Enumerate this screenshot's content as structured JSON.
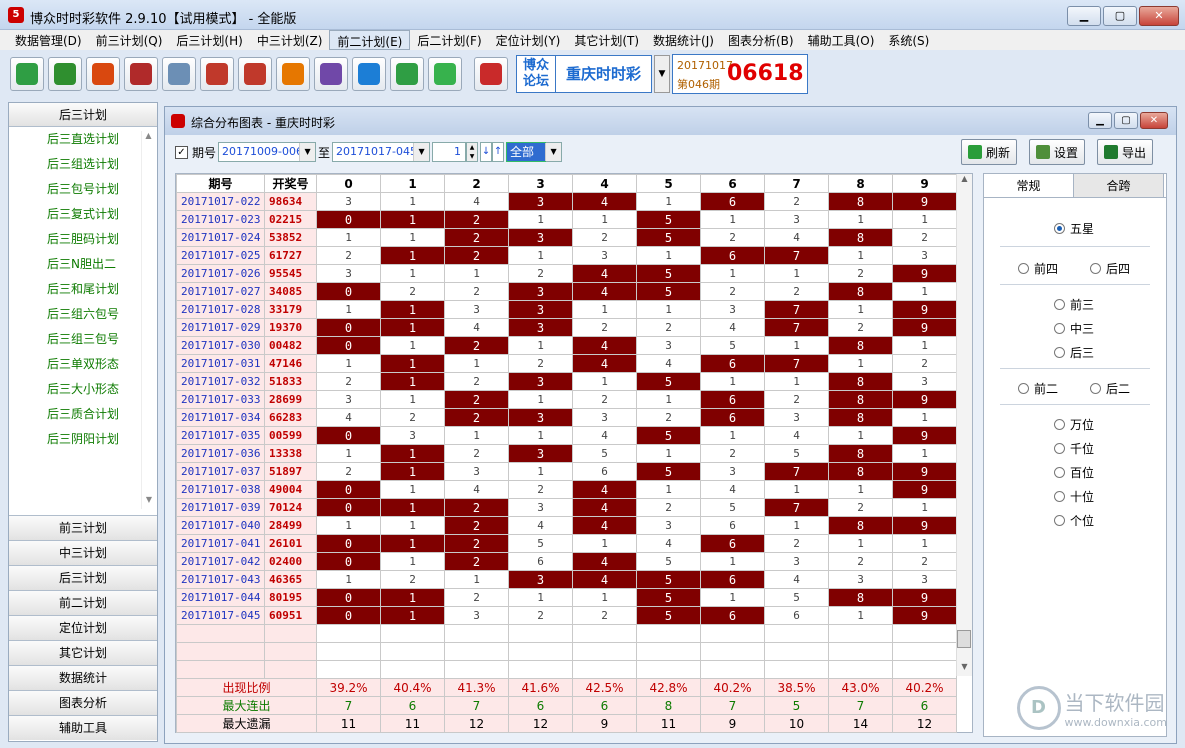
{
  "window": {
    "title": "博众时时彩软件 2.9.10【试用模式】 - 全能版",
    "icon_text": "5"
  },
  "menu": [
    "数据管理(D)",
    "前三计划(Q)",
    "后三计划(H)",
    "中三计划(Z)",
    "前二计划(E)",
    "后二计划(F)",
    "定位计划(Y)",
    "其它计划(T)",
    "数据统计(J)",
    "图表分析(B)",
    "辅助工具(O)",
    "系统(S)"
  ],
  "toolbar": {
    "icons": [
      "database-icon",
      "download-icon",
      "pie-chart-icon",
      "grid-chart-icon",
      "line-chart-icon",
      "bar-chart-icon",
      "bar-chart-icon",
      "alarm-icon",
      "matrix-icon",
      "calculator-icon",
      "gear-icon",
      "refresh-icon",
      "lottery-icon"
    ],
    "forum_logo": "博众\n论坛",
    "lottery_name": "重庆时时彩",
    "draw_date": "20171017",
    "draw_period": "第046期",
    "draw_number": "06618"
  },
  "sidebar": {
    "header": "后三计划",
    "links": [
      "后三直选计划",
      "后三组选计划",
      "后三包号计划",
      "后三复式计划",
      "后三胆码计划",
      "后三N胆出二",
      "后三和尾计划",
      "后三组六包号",
      "后三组三包号",
      "后三单双形态",
      "后三大小形态",
      "后三质合计划",
      "后三阴阳计划"
    ],
    "buttons": [
      "前三计划",
      "中三计划",
      "后三计划",
      "前二计划",
      "定位计划",
      "其它计划",
      "数据统计",
      "图表分析",
      "辅助工具"
    ]
  },
  "child": {
    "title": "综合分布图表 - 重庆时时彩"
  },
  "filter": {
    "checkbox_label": "期号",
    "from": "20171009-006",
    "to_label": "至",
    "to": "20171017-045",
    "step": "1",
    "range": "全部",
    "refresh": "刷新",
    "settings": "设置",
    "export": "导出"
  },
  "table": {
    "headers": [
      "期号",
      "开奖号",
      "0",
      "1",
      "2",
      "3",
      "4",
      "5",
      "6",
      "7",
      "8",
      "9"
    ],
    "rows": [
      {
        "period": "20171017-022",
        "num": "98634",
        "cells": [
          "3",
          "1",
          "4",
          "3",
          "4",
          "1",
          "6",
          "2",
          "8",
          "9"
        ],
        "hits": [
          3,
          4,
          6,
          8,
          9
        ]
      },
      {
        "period": "20171017-023",
        "num": "02215",
        "cells": [
          "0",
          "1",
          "2",
          "1",
          "1",
          "5",
          "1",
          "3",
          "1",
          "1"
        ],
        "hits": [
          0,
          1,
          2,
          5
        ]
      },
      {
        "period": "20171017-024",
        "num": "53852",
        "cells": [
          "1",
          "1",
          "2",
          "3",
          "2",
          "5",
          "2",
          "4",
          "8",
          "2"
        ],
        "hits": [
          2,
          3,
          5,
          8
        ]
      },
      {
        "period": "20171017-025",
        "num": "61727",
        "cells": [
          "2",
          "1",
          "2",
          "1",
          "3",
          "1",
          "6",
          "7",
          "1",
          "3"
        ],
        "hits": [
          1,
          2,
          6,
          7
        ]
      },
      {
        "period": "20171017-026",
        "num": "95545",
        "cells": [
          "3",
          "1",
          "1",
          "2",
          "4",
          "5",
          "1",
          "1",
          "2",
          "9"
        ],
        "hits": [
          4,
          5,
          9
        ]
      },
      {
        "period": "20171017-027",
        "num": "34085",
        "cells": [
          "0",
          "2",
          "2",
          "3",
          "4",
          "5",
          "2",
          "2",
          "8",
          "1"
        ],
        "hits": [
          0,
          3,
          4,
          5,
          8
        ]
      },
      {
        "period": "20171017-028",
        "num": "33179",
        "cells": [
          "1",
          "1",
          "3",
          "3",
          "1",
          "1",
          "3",
          "7",
          "1",
          "9"
        ],
        "hits": [
          1,
          3,
          7,
          9
        ]
      },
      {
        "period": "20171017-029",
        "num": "19370",
        "cells": [
          "0",
          "1",
          "4",
          "3",
          "2",
          "2",
          "4",
          "7",
          "2",
          "9"
        ],
        "hits": [
          0,
          1,
          3,
          7,
          9
        ]
      },
      {
        "period": "20171017-030",
        "num": "00482",
        "cells": [
          "0",
          "1",
          "2",
          "1",
          "4",
          "3",
          "5",
          "1",
          "8",
          "1"
        ],
        "hits": [
          0,
          2,
          4,
          8
        ]
      },
      {
        "period": "20171017-031",
        "num": "47146",
        "cells": [
          "1",
          "1",
          "1",
          "2",
          "4",
          "4",
          "6",
          "7",
          "1",
          "2"
        ],
        "hits": [
          1,
          4,
          6,
          7
        ]
      },
      {
        "period": "20171017-032",
        "num": "51833",
        "cells": [
          "2",
          "1",
          "2",
          "3",
          "1",
          "5",
          "1",
          "1",
          "8",
          "3"
        ],
        "hits": [
          1,
          3,
          5,
          8
        ]
      },
      {
        "period": "20171017-033",
        "num": "28699",
        "cells": [
          "3",
          "1",
          "2",
          "1",
          "2",
          "1",
          "6",
          "2",
          "8",
          "9"
        ],
        "hits": [
          2,
          6,
          8,
          9
        ]
      },
      {
        "period": "20171017-034",
        "num": "66283",
        "cells": [
          "4",
          "2",
          "2",
          "3",
          "3",
          "2",
          "6",
          "3",
          "8",
          "1"
        ],
        "hits": [
          2,
          3,
          6,
          8
        ]
      },
      {
        "period": "20171017-035",
        "num": "00599",
        "cells": [
          "0",
          "3",
          "1",
          "1",
          "4",
          "5",
          "1",
          "4",
          "1",
          "9"
        ],
        "hits": [
          0,
          5,
          9
        ]
      },
      {
        "period": "20171017-036",
        "num": "13338",
        "cells": [
          "1",
          "1",
          "2",
          "3",
          "5",
          "1",
          "2",
          "5",
          "8",
          "1"
        ],
        "hits": [
          1,
          3,
          8
        ]
      },
      {
        "period": "20171017-037",
        "num": "51897",
        "cells": [
          "2",
          "1",
          "3",
          "1",
          "6",
          "5",
          "3",
          "7",
          "8",
          "9"
        ],
        "hits": [
          1,
          5,
          7,
          8,
          9
        ]
      },
      {
        "period": "20171017-038",
        "num": "49004",
        "cells": [
          "0",
          "1",
          "4",
          "2",
          "4",
          "1",
          "4",
          "1",
          "1",
          "9"
        ],
        "hits": [
          0,
          4,
          9
        ]
      },
      {
        "period": "20171017-039",
        "num": "70124",
        "cells": [
          "0",
          "1",
          "2",
          "3",
          "4",
          "2",
          "5",
          "7",
          "2",
          "1"
        ],
        "hits": [
          0,
          1,
          2,
          4,
          7
        ]
      },
      {
        "period": "20171017-040",
        "num": "28499",
        "cells": [
          "1",
          "1",
          "2",
          "4",
          "4",
          "3",
          "6",
          "1",
          "8",
          "9"
        ],
        "hits": [
          2,
          4,
          8,
          9
        ]
      },
      {
        "period": "20171017-041",
        "num": "26101",
        "cells": [
          "0",
          "1",
          "2",
          "5",
          "1",
          "4",
          "6",
          "2",
          "1",
          "1"
        ],
        "hits": [
          0,
          1,
          2,
          6
        ]
      },
      {
        "period": "20171017-042",
        "num": "02400",
        "cells": [
          "0",
          "1",
          "2",
          "6",
          "4",
          "5",
          "1",
          "3",
          "2",
          "2"
        ],
        "hits": [
          0,
          2,
          4
        ]
      },
      {
        "period": "20171017-043",
        "num": "46365",
        "cells": [
          "1",
          "2",
          "1",
          "3",
          "4",
          "5",
          "6",
          "4",
          "3",
          "3"
        ],
        "hits": [
          3,
          4,
          5,
          6
        ]
      },
      {
        "period": "20171017-044",
        "num": "80195",
        "cells": [
          "0",
          "1",
          "2",
          "1",
          "1",
          "5",
          "1",
          "5",
          "8",
          "9"
        ],
        "hits": [
          0,
          1,
          5,
          8,
          9
        ]
      },
      {
        "period": "20171017-045",
        "num": "60951",
        "cells": [
          "0",
          "1",
          "3",
          "2",
          "2",
          "5",
          "6",
          "6",
          "1",
          "9"
        ],
        "hits": [
          0,
          1,
          5,
          6,
          9
        ]
      }
    ],
    "stats": [
      {
        "label": "出现比例",
        "cls": "",
        "values": [
          "39.2%",
          "40.4%",
          "41.3%",
          "41.6%",
          "42.5%",
          "42.8%",
          "40.2%",
          "38.5%",
          "43.0%",
          "40.2%"
        ]
      },
      {
        "label": "最大连出",
        "cls": "g",
        "values": [
          "7",
          "6",
          "7",
          "6",
          "6",
          "8",
          "7",
          "5",
          "7",
          "6"
        ]
      },
      {
        "label": "最大遗漏",
        "cls": "b",
        "values": [
          "11",
          "11",
          "12",
          "12",
          "9",
          "11",
          "9",
          "10",
          "14",
          "12"
        ]
      }
    ]
  },
  "right_panel": {
    "tabs": [
      "常规",
      "合跨"
    ],
    "options": [
      "五星",
      "前四",
      "后四",
      "前三",
      "中三",
      "后三",
      "前二",
      "后二",
      "万位",
      "千位",
      "百位",
      "十位",
      "个位"
    ],
    "selected": "五星"
  },
  "watermark": {
    "mark": "D",
    "name": "当下软件园",
    "url": "www.downxia.com"
  }
}
